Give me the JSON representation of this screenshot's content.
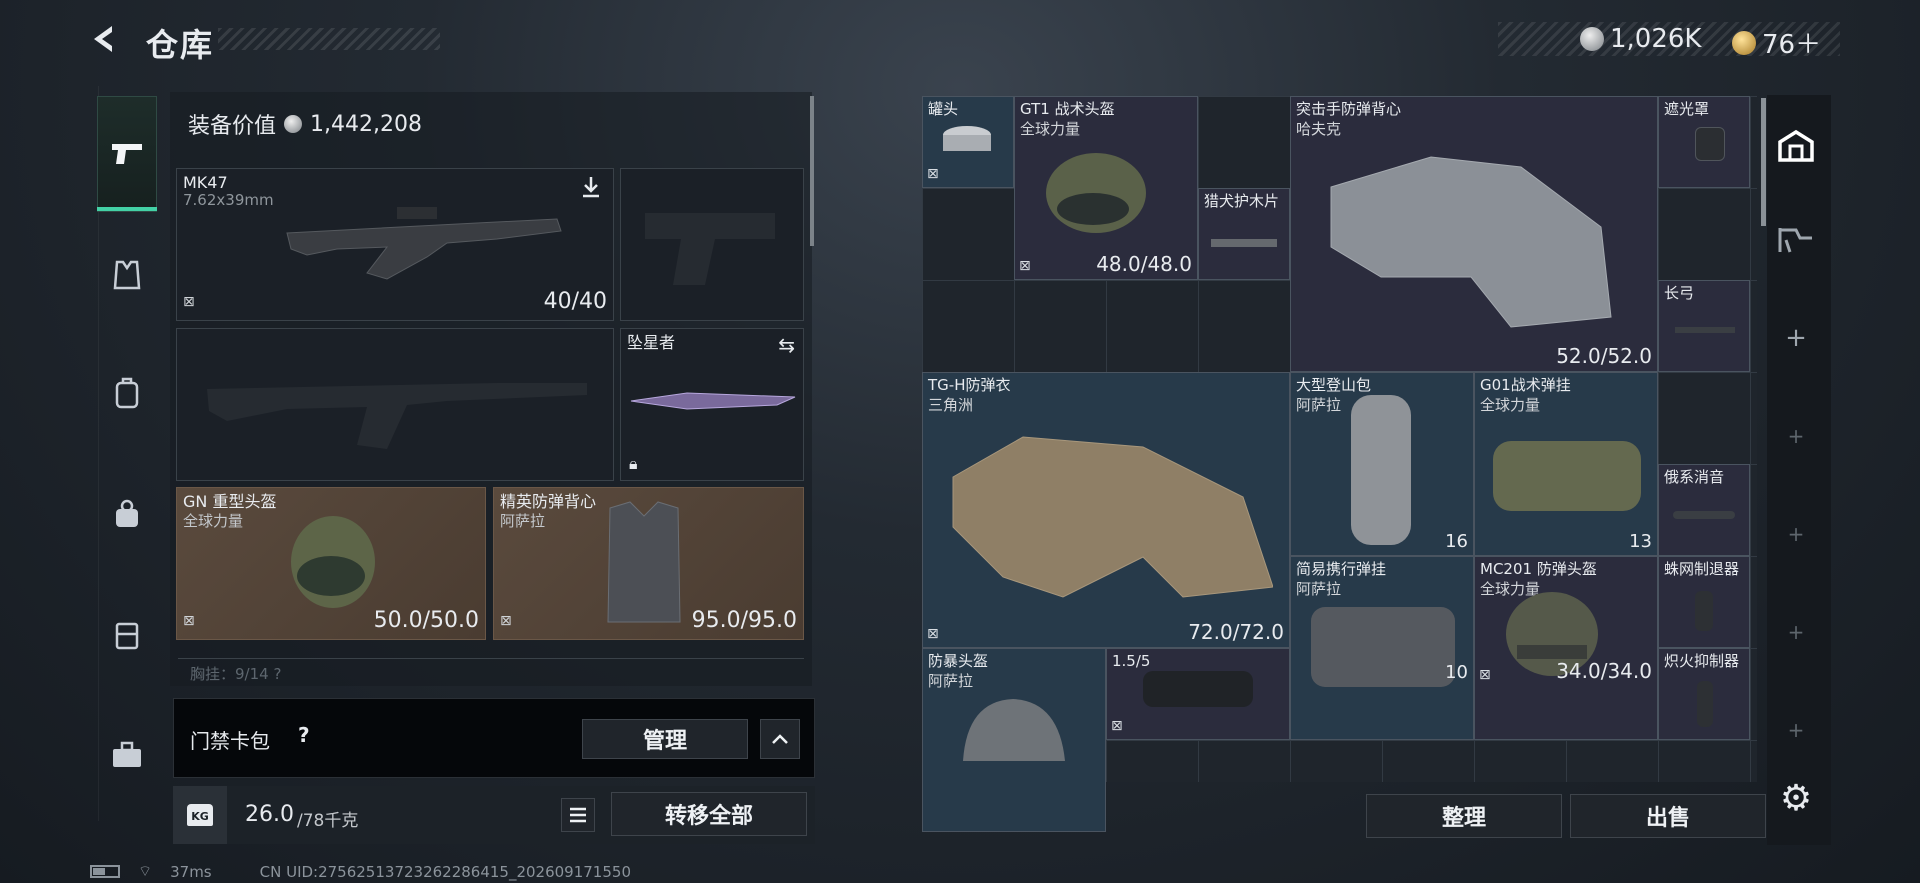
{
  "header": {
    "title": "仓库",
    "currency_silver": "1,026K",
    "currency_gold": "76＋"
  },
  "sidebar": {
    "tabs": [
      {
        "icon": "pistol-icon"
      },
      {
        "icon": "vest-icon"
      },
      {
        "icon": "backpack-icon"
      },
      {
        "icon": "pouch-icon"
      },
      {
        "icon": "case-icon"
      },
      {
        "icon": "briefcase-icon"
      }
    ]
  },
  "loadout": {
    "value_label": "装备价值",
    "value": "1,442,208",
    "primary": {
      "name": "MK47",
      "caliber": "7.62x39mm",
      "durability": "40/40"
    },
    "melee": {
      "name": "坠星者"
    },
    "helmet": {
      "name": "GN 重型头盔",
      "brand": "全球力量",
      "durability": "50.0/50.0"
    },
    "armor": {
      "name": "精英防弹背心",
      "brand": "阿萨拉",
      "durability": "95.0/95.0"
    },
    "pocket": "胸挂：9/14   ?"
  },
  "card_pack": {
    "label": "门禁卡包",
    "help": "?",
    "manage": "管理",
    "collapse": "^"
  },
  "weight": {
    "icon_label": "KG",
    "current": "26.0",
    "max": "/78千克",
    "transfer_all": "转移全部"
  },
  "stash": {
    "items": [
      {
        "name": "罐头",
        "sub": ""
      },
      {
        "name": "GT1 战术头盔",
        "sub": "全球力量",
        "dur": "48.0/48.0"
      },
      {
        "name": "猎犬护木片",
        "sub": ""
      },
      {
        "name": "突击手防弹背心",
        "sub": "哈夫克",
        "dur": "52.0/52.0"
      },
      {
        "name": "遮光罩",
        "sub": ""
      },
      {
        "name": "长弓",
        "sub": ""
      },
      {
        "name": "TG-H防弹衣",
        "sub": "三角洲",
        "dur": "72.0/72.0"
      },
      {
        "name": "大型登山包",
        "sub": "阿萨拉",
        "dur": "16"
      },
      {
        "name": "G01战术弹挂",
        "sub": "全球力量",
        "dur": "13"
      },
      {
        "name": "俄系消音",
        "sub": ""
      },
      {
        "name": "简易携行弹挂",
        "sub": "阿萨拉",
        "dur": "10"
      },
      {
        "name": "MC201 防弹头盔",
        "sub": "全球力量",
        "dur": "34.0/34.0"
      },
      {
        "name": "蛛网制退器",
        "sub": ""
      },
      {
        "name": "防暴头盔",
        "sub": "阿萨拉"
      },
      {
        "name": "1.5/5",
        "sub": ""
      },
      {
        "name": "炽火抑制器",
        "sub": ""
      }
    ],
    "sort": "整理",
    "sell": "出售"
  },
  "status": {
    "ping": "37ms",
    "uid": "CN UID:27562513723262286415_202609171550"
  },
  "colors": {
    "accent": "#43d1a6",
    "purple_rarity": "#2b2c3d",
    "blue_rarity": "#273a4a",
    "brown_rarity": "#5a4a3d"
  }
}
